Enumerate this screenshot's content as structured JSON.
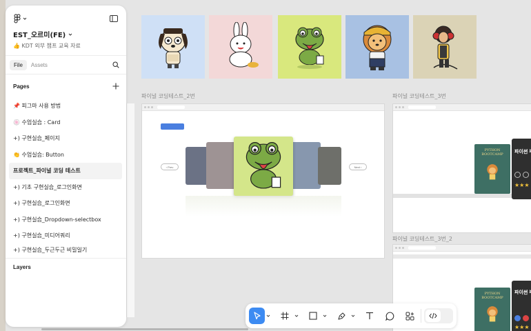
{
  "file": {
    "name": "EST_오르미(FE)",
    "subtitle": "👍 KDT 외부 챔프 교육 자료"
  },
  "tabs": [
    {
      "label": "File",
      "active": true
    },
    {
      "label": "Assets",
      "active": false
    }
  ],
  "pages": {
    "title": "Pages",
    "items": [
      {
        "label": "📌 피그마 사용 방법"
      },
      {
        "label": "🍥 수업실습 : Card"
      },
      {
        "label": "+) 구현실습_페이지"
      },
      {
        "label": "👏 수업실습: Button"
      },
      {
        "label": "프로젝트_파이널 코딩 테스트",
        "active": true
      },
      {
        "label": "+) 기초 구현실습_로그인화면"
      },
      {
        "label": "+) 구현실습_로그인화면"
      },
      {
        "label": "+) 구현실습_Dropdown-selectbox"
      },
      {
        "label": "+) 구현실습_미디어쿼리"
      },
      {
        "label": "+) 구현실습_두근두근 비밀일기"
      }
    ]
  },
  "layers": {
    "title": "Layers"
  },
  "canvas": {
    "frames": [
      {
        "label": "파이널 코딩테스트_2번"
      },
      {
        "label": "파이널 코딩테스트_3번"
      },
      {
        "label": "파이널 코딩테스트_3번_2"
      }
    ],
    "thumbnails": [
      {
        "character": "dog",
        "bg": "#cfe0f6"
      },
      {
        "character": "rabbit",
        "bg": "#f3d8d8"
      },
      {
        "character": "frog",
        "bg": "#d9e87d"
      },
      {
        "character": "lion",
        "bg": "#a8c1e3"
      },
      {
        "character": "girl",
        "bg": "#dbd3b6"
      }
    ]
  },
  "toolbar": {
    "tools": [
      "move-tool",
      "frame-tool",
      "shape-tool",
      "pen-tool",
      "text-tool",
      "comment-tool",
      "actions-tool",
      "dev-mode-toggle"
    ]
  },
  "colors": {
    "accent": "#3d8bf2",
    "panel": "#ffffff",
    "canvas": "#e5e5e5"
  }
}
